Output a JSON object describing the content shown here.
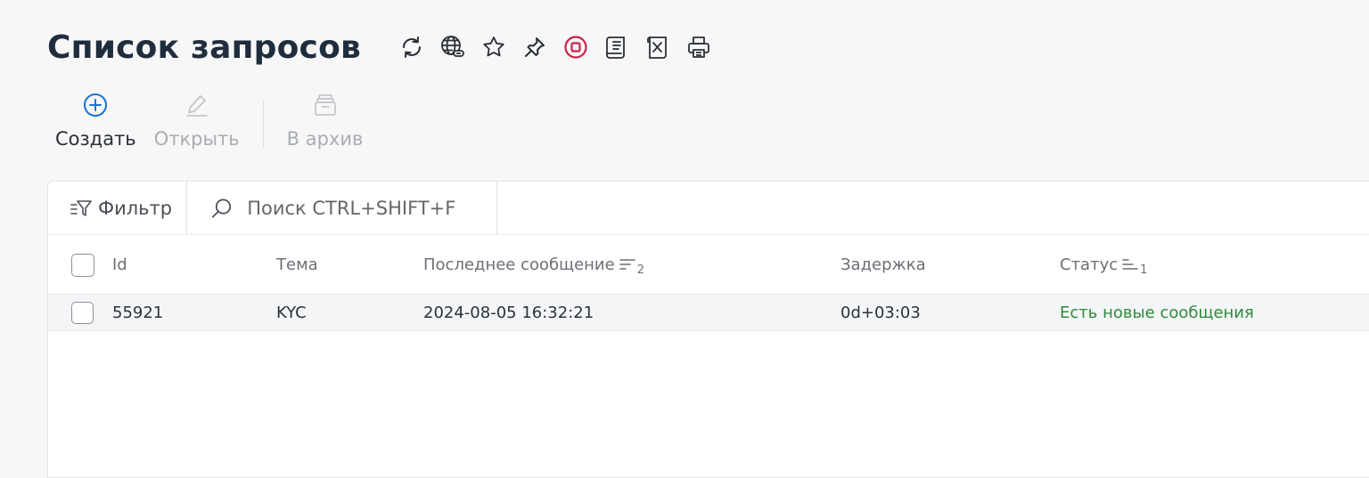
{
  "header": {
    "title": "Список запросов",
    "icons": [
      "refresh-icon",
      "globe-link-icon",
      "star-icon",
      "pin-icon",
      "stop-icon",
      "scroll-icon",
      "excel-icon",
      "print-icon"
    ]
  },
  "toolbar": {
    "create_label": "Создать",
    "open_label": "Открыть",
    "archive_label": "В архив"
  },
  "filterbar": {
    "filter_label": "Фильтр",
    "search_placeholder": "Поиск CTRL+SHIFT+F"
  },
  "table": {
    "columns": {
      "id": "Id",
      "topic": "Тема",
      "last_message": "Последнее сообщение",
      "last_message_sort_order": "2",
      "delay": "Задержка",
      "status": "Статус",
      "status_sort_order": "1"
    },
    "rows": [
      {
        "id": "55921",
        "topic": "KYC",
        "last_message": "2024-08-05 16:32:21",
        "delay": "0d+03:03",
        "status": "Есть новые сообщения"
      }
    ]
  },
  "colors": {
    "title": "#1f2d3d",
    "accent": "#1a73d6",
    "stop": "#c8224a",
    "status_new": "#2e8b3b",
    "disabled": "#a9adb2"
  }
}
